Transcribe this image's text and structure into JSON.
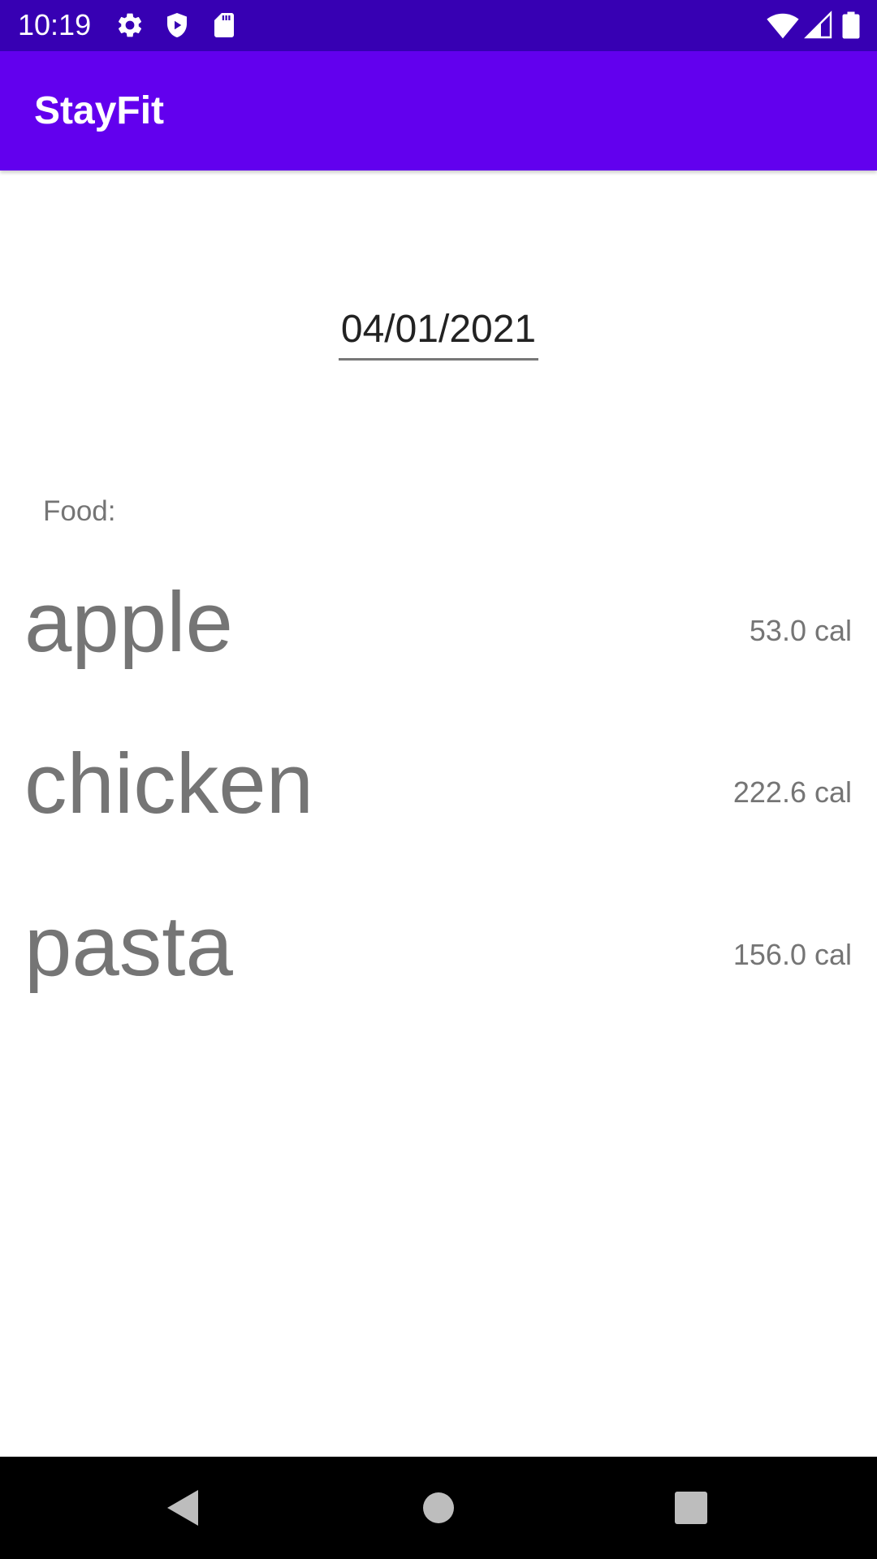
{
  "status_bar": {
    "time": "10:19",
    "icons": [
      "gear-icon",
      "shield-icon",
      "sd-card-icon",
      "wifi-icon",
      "signal-icon",
      "battery-icon"
    ]
  },
  "app_bar": {
    "title": "StayFit",
    "color": "#6200ee",
    "status_color": "#3700b3"
  },
  "date_field": {
    "value": "04/01/2021"
  },
  "food_section": {
    "label": "Food:",
    "items": [
      {
        "name": "apple",
        "calories": "53.0 cal"
      },
      {
        "name": "chicken",
        "calories": "222.6 cal"
      },
      {
        "name": "pasta",
        "calories": "156.0 cal"
      }
    ]
  },
  "nav_bar": {
    "buttons": [
      "back-icon",
      "home-icon",
      "recents-icon"
    ]
  }
}
